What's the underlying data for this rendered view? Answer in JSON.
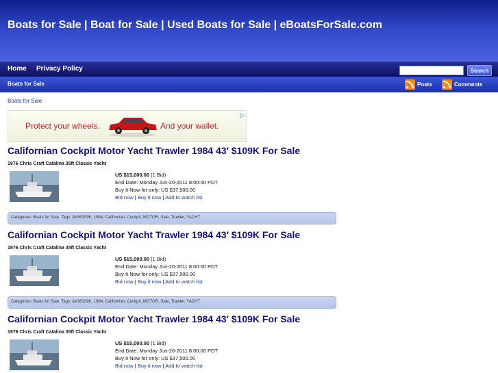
{
  "header": {
    "site_title": "Boats for Sale | Boat for Sale | Used Boats for Sale | eBoatsForSale.com"
  },
  "nav": {
    "items": [
      {
        "label": "Home"
      },
      {
        "label": "Privacy Policy"
      }
    ]
  },
  "search": {
    "button_label": "Search",
    "value": "",
    "placeholder": ""
  },
  "subnav": {
    "link": "Boats for Sale",
    "feeds": [
      {
        "label": "Posts",
        "icon": "rss-icon"
      },
      {
        "label": "Comments",
        "icon": "rss-icon"
      }
    ]
  },
  "breadcrumb": "Boats for Sale",
  "ad": {
    "text_left": "Protect your wheels.",
    "text_right": "And your wallet.",
    "choice_icon": "ad-choices-icon"
  },
  "posts": [
    {
      "title": "Californian Cockpit Motor Yacht Trawler 1984 43′ $109K For Sale",
      "item_title": "1976 Chris Craft Catalina 35ft Classic Yacht",
      "price": "US $15,000.00",
      "bids": " (1 Bid)",
      "end_date": "End Date: Monday Jun-20-2011 8:00:00 PDT",
      "buy_now": "Buy It Now for only: US $37,500.00",
      "link_bid": "Bid now",
      "link_buy": "Buy it now",
      "link_watch": "Add to watch list",
      "sep": " | ",
      "categories_label": "Categories: ",
      "category": "Boats for Sale",
      "tags_label": "Tags: ",
      "tags": "&#36109K, 1984, Californian, Cockpit, MOTOR, Sale, Trawler, YACHT"
    },
    {
      "title": "Californian Cockpit Motor Yacht Trawler 1984 43′ $109K For Sale",
      "item_title": "1976 Chris Craft Catalina 35ft Classic Yacht",
      "price": "US $15,000.00",
      "bids": " (1 Bid)",
      "end_date": "End Date: Monday Jun-20-2011 8:00:00 PDT",
      "buy_now": "Buy It Now for only: US $37,500.00",
      "link_bid": "Bid now",
      "link_buy": "Buy it now",
      "link_watch": "Add to watch list",
      "sep": " | ",
      "categories_label": "Categories: ",
      "category": "Boats for Sale",
      "tags_label": "Tags: ",
      "tags": "&#36109K, 1984, Californian, Cockpit, MOTOR, Sale, Trawler, YACHT"
    },
    {
      "title": "Californian Cockpit Motor Yacht Trawler 1984 43′ $109K For Sale",
      "item_title": "1976 Chris Craft Catalina 35ft Classic Yacht",
      "price": "US $15,000.00",
      "bids": " (1 Bid)",
      "end_date": "End Date: Monday Jun-20-2011 8:00:00 PDT",
      "buy_now": "Buy It Now for only: US $37,500.00",
      "link_bid": "Bid now",
      "link_buy": "Buy it now",
      "link_watch": "Add to watch list",
      "sep": " | "
    }
  ]
}
